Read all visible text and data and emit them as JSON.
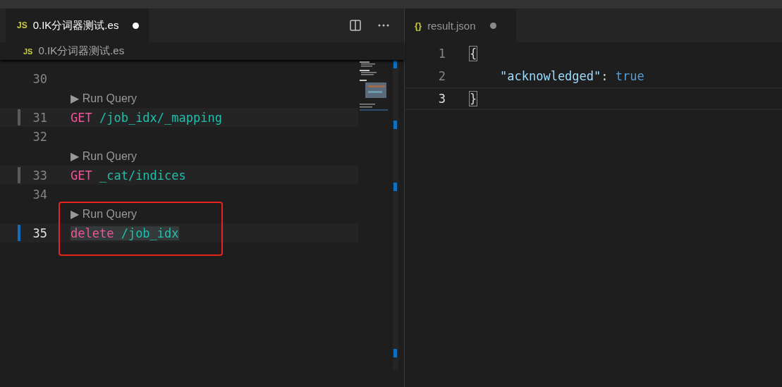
{
  "left_pane": {
    "tabs": [
      {
        "label": "0.IK分词器测试.es",
        "icon": "JS",
        "selected": true,
        "modified": true
      }
    ],
    "breadcrumb": {
      "icon": "JS",
      "label": "0.IK分词器测试.es"
    },
    "rows": [
      {
        "kind": "blank",
        "number": "30"
      },
      {
        "kind": "query",
        "lens": "▶ Run Query",
        "number": "31",
        "active": false,
        "highlighted": false,
        "boxed": false,
        "tokens": [
          {
            "kind": "method",
            "text": "GET"
          },
          {
            "kind": "path",
            "text": "/job_idx/_mapping"
          }
        ]
      },
      {
        "kind": "blank",
        "number": "32"
      },
      {
        "kind": "query",
        "lens": "▶ Run Query",
        "number": "33",
        "active": false,
        "highlighted": false,
        "boxed": false,
        "tokens": [
          {
            "kind": "method",
            "text": "GET"
          },
          {
            "kind": "path",
            "text": "_cat/indices"
          }
        ]
      },
      {
        "kind": "blank",
        "number": "34"
      },
      {
        "kind": "query",
        "lens": "▶ Run Query",
        "number": "35",
        "active": true,
        "highlighted": true,
        "boxed": true,
        "tokens": [
          {
            "kind": "method",
            "text": "delete"
          },
          {
            "kind": "path",
            "text": "/job_idx"
          }
        ]
      }
    ]
  },
  "right_pane": {
    "tabs": [
      {
        "label": "result.json",
        "icon": "{}",
        "selected": false,
        "modified": true
      }
    ],
    "lines": [
      {
        "number": "1",
        "active": false,
        "tokens": [
          {
            "kind": "bracket",
            "text": "{"
          }
        ]
      },
      {
        "number": "2",
        "active": false,
        "tokens": [
          {
            "kind": "key",
            "text": "\"acknowledged\""
          },
          {
            "kind": "punct",
            "text": ": "
          },
          {
            "kind": "bool",
            "text": "true"
          }
        ]
      },
      {
        "number": "3",
        "active": true,
        "tokens": [
          {
            "kind": "bracket",
            "text": "}"
          }
        ]
      }
    ]
  }
}
